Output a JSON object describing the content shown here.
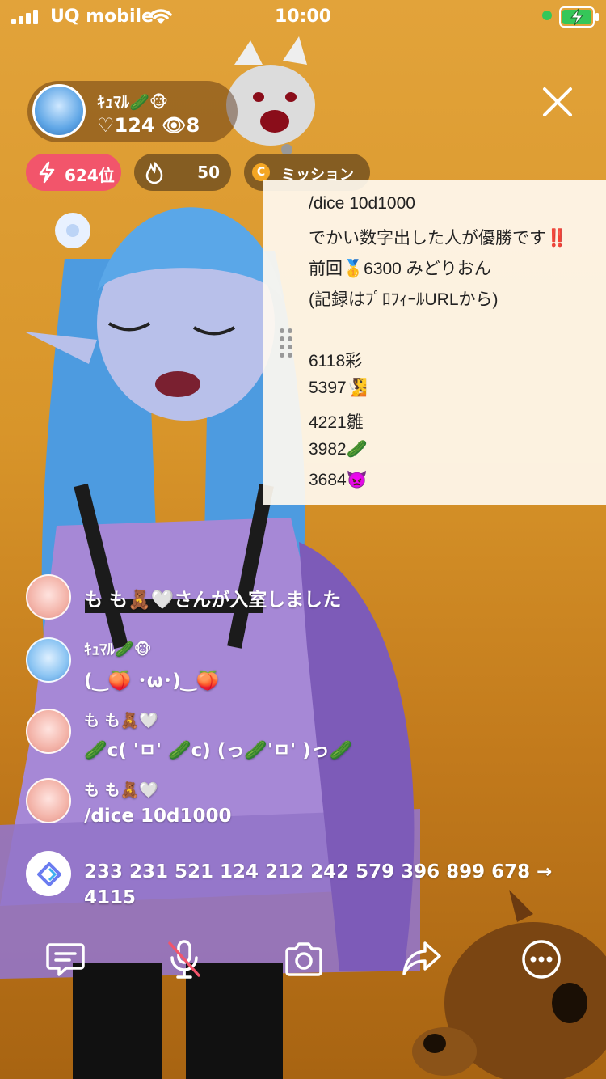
{
  "status_bar": {
    "carrier": "UQ mobile",
    "time": "10:00",
    "icons": [
      "signal-icon",
      "wifi-icon",
      "battery-charging-icon"
    ]
  },
  "header": {
    "host_name": "ｷｭﾏﾙ🥒🐵",
    "likes": "♡124",
    "viewers": "👁8",
    "close_icon": "close-icon"
  },
  "badges": {
    "rank": "624位",
    "fire": "50",
    "mission": "ミッション",
    "coin_letter": "C"
  },
  "info_panel": {
    "lines": [
      "/dice 10d1000",
      "でかい数字出した人が優勝です‼️",
      "前回🥇6300 みどりおん",
      "(記録はﾌﾟﾛﾌｨｰﾙURLから)",
      "",
      "6118彩",
      "5397🧏",
      "4221雛",
      "3982🥒",
      "3684👿"
    ]
  },
  "chat": [
    {
      "name": "",
      "message": "も も🧸🤍さんが入室しました",
      "avatar": "pink"
    },
    {
      "name": "ｷｭﾏﾙ🥒🐵",
      "message": "(‿🍑 ･ω･)‿🍑",
      "avatar": "blue"
    },
    {
      "name": "も も🧸🤍",
      "message": "🥒c( 'ㅁ' 🥒c) (っ🥒'ㅁ' )っ🥒",
      "avatar": "pink"
    },
    {
      "name": "も も🧸🤍",
      "message": "/dice 10d1000",
      "avatar": "pink"
    },
    {
      "name": "",
      "message": "233 231 521 124 212 242 579 396 899 678 →\n4115",
      "avatar": "app"
    }
  ],
  "toolbar": {
    "icons": [
      "comment-icon",
      "mic-muted-icon",
      "camera-icon",
      "share-icon",
      "more-icon"
    ]
  },
  "colors": {
    "rank_badge": "#f2556b",
    "coin": "#f4a623",
    "background": "#d8952a"
  }
}
